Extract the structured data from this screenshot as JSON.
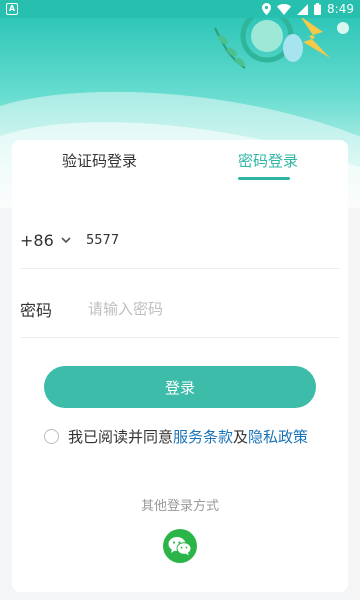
{
  "status_bar": {
    "left_icon": "app-notification-icon",
    "time": "8:49",
    "icons": [
      "location-icon",
      "wifi-icon",
      "signal-icon",
      "battery-icon"
    ]
  },
  "tabs": {
    "code_login": "验证码登录",
    "password_login": "密码登录",
    "active": "password_login"
  },
  "phone": {
    "country_code": "+86",
    "value": "5577"
  },
  "password": {
    "label": "密码",
    "placeholder": "请输入密码"
  },
  "login_button": "登录",
  "agreement": {
    "prefix": "我已阅读并同意",
    "terms": "服务条款",
    "and": "及",
    "privacy": "隐私政策",
    "checked": false
  },
  "other_login": {
    "label": "其他登录方式",
    "methods": [
      "wechat-icon"
    ]
  },
  "colors": {
    "accent": "#2fb5a6",
    "button": "#3dbcaa",
    "link": "#1a73b8",
    "wechat": "#2bb548"
  }
}
